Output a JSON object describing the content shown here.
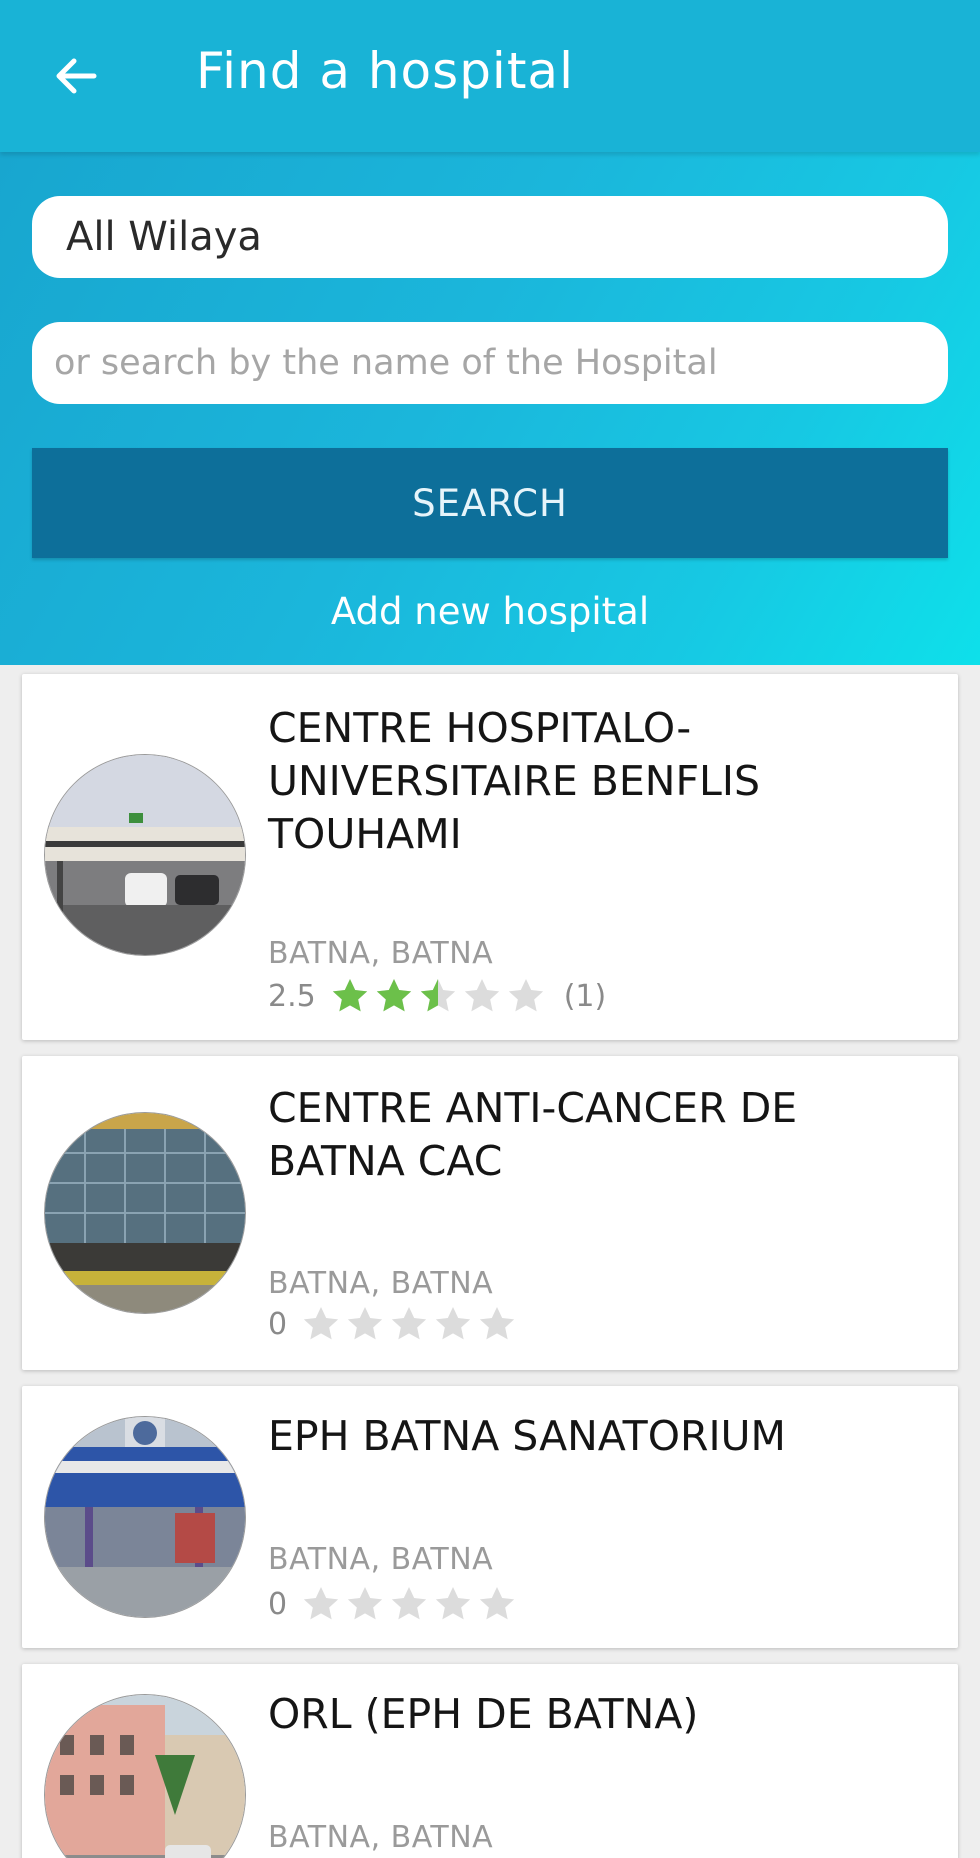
{
  "appbar": {
    "title": "Find a hospital"
  },
  "search": {
    "wilaya": "All Wilaya",
    "placeholder": "or search by the name of the Hospital",
    "button_label": "SEARCH",
    "add_link": "Add new hospital"
  },
  "colors": {
    "appbar": "#19b3d6",
    "button": "#0d6f9a",
    "star_filled": "#6cc04a",
    "star_empty": "#dcdcdc"
  },
  "hospitals": [
    {
      "name": " CENTRE HOSPITALO-UNIVERSITAIRE BENFLIS TOUHAMI",
      "location": "BATNA, BATNA",
      "rating": "2.5",
      "stars": 2.5,
      "count": "(1)"
    },
    {
      "name": " CENTRE ANTI-CANCER DE BATNA CAC",
      "location": "BATNA, BATNA",
      "rating": "0",
      "stars": 0,
      "count": ""
    },
    {
      "name": " EPH BATNA SANATORIUM",
      "location": "BATNA, BATNA",
      "rating": "0",
      "stars": 0,
      "count": ""
    },
    {
      "name": " ORL (EPH DE BATNA)",
      "location": "BATNA, BATNA",
      "rating": "0",
      "stars": 0,
      "count": ""
    }
  ]
}
